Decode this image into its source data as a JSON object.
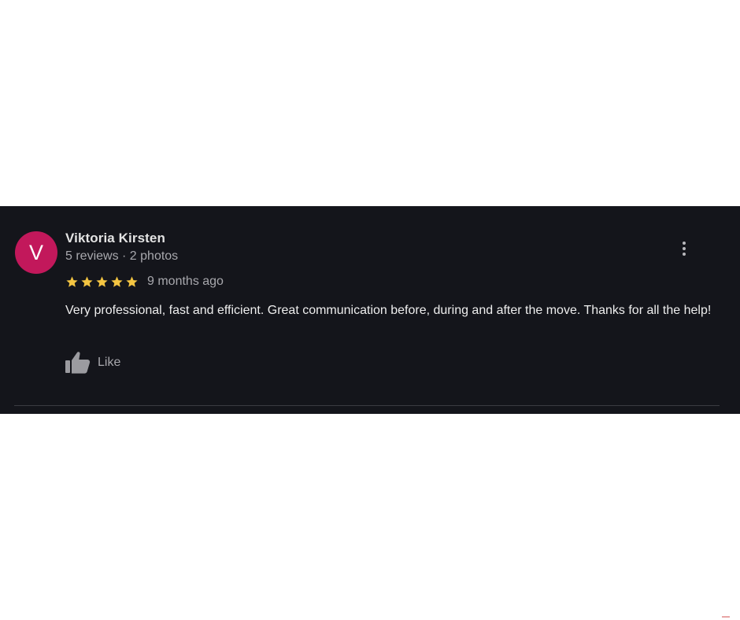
{
  "review": {
    "avatar_letter": "V",
    "avatar_color": "#c2185b",
    "reviewer_name": "Viktoria Kirsten",
    "reviewer_meta": "5 reviews · 2 photos",
    "rating": 5,
    "star_color": "#f4c542",
    "date": "9 months ago",
    "text": "Very professional, fast and efficient. Great communication before, during and after the move. Thanks for all the help!",
    "like_label": "Like",
    "more_icon": "more-vert-icon",
    "like_icon": "thumb-up-icon"
  },
  "colors": {
    "card_background": "#14151b",
    "page_background": "#ffffff"
  }
}
